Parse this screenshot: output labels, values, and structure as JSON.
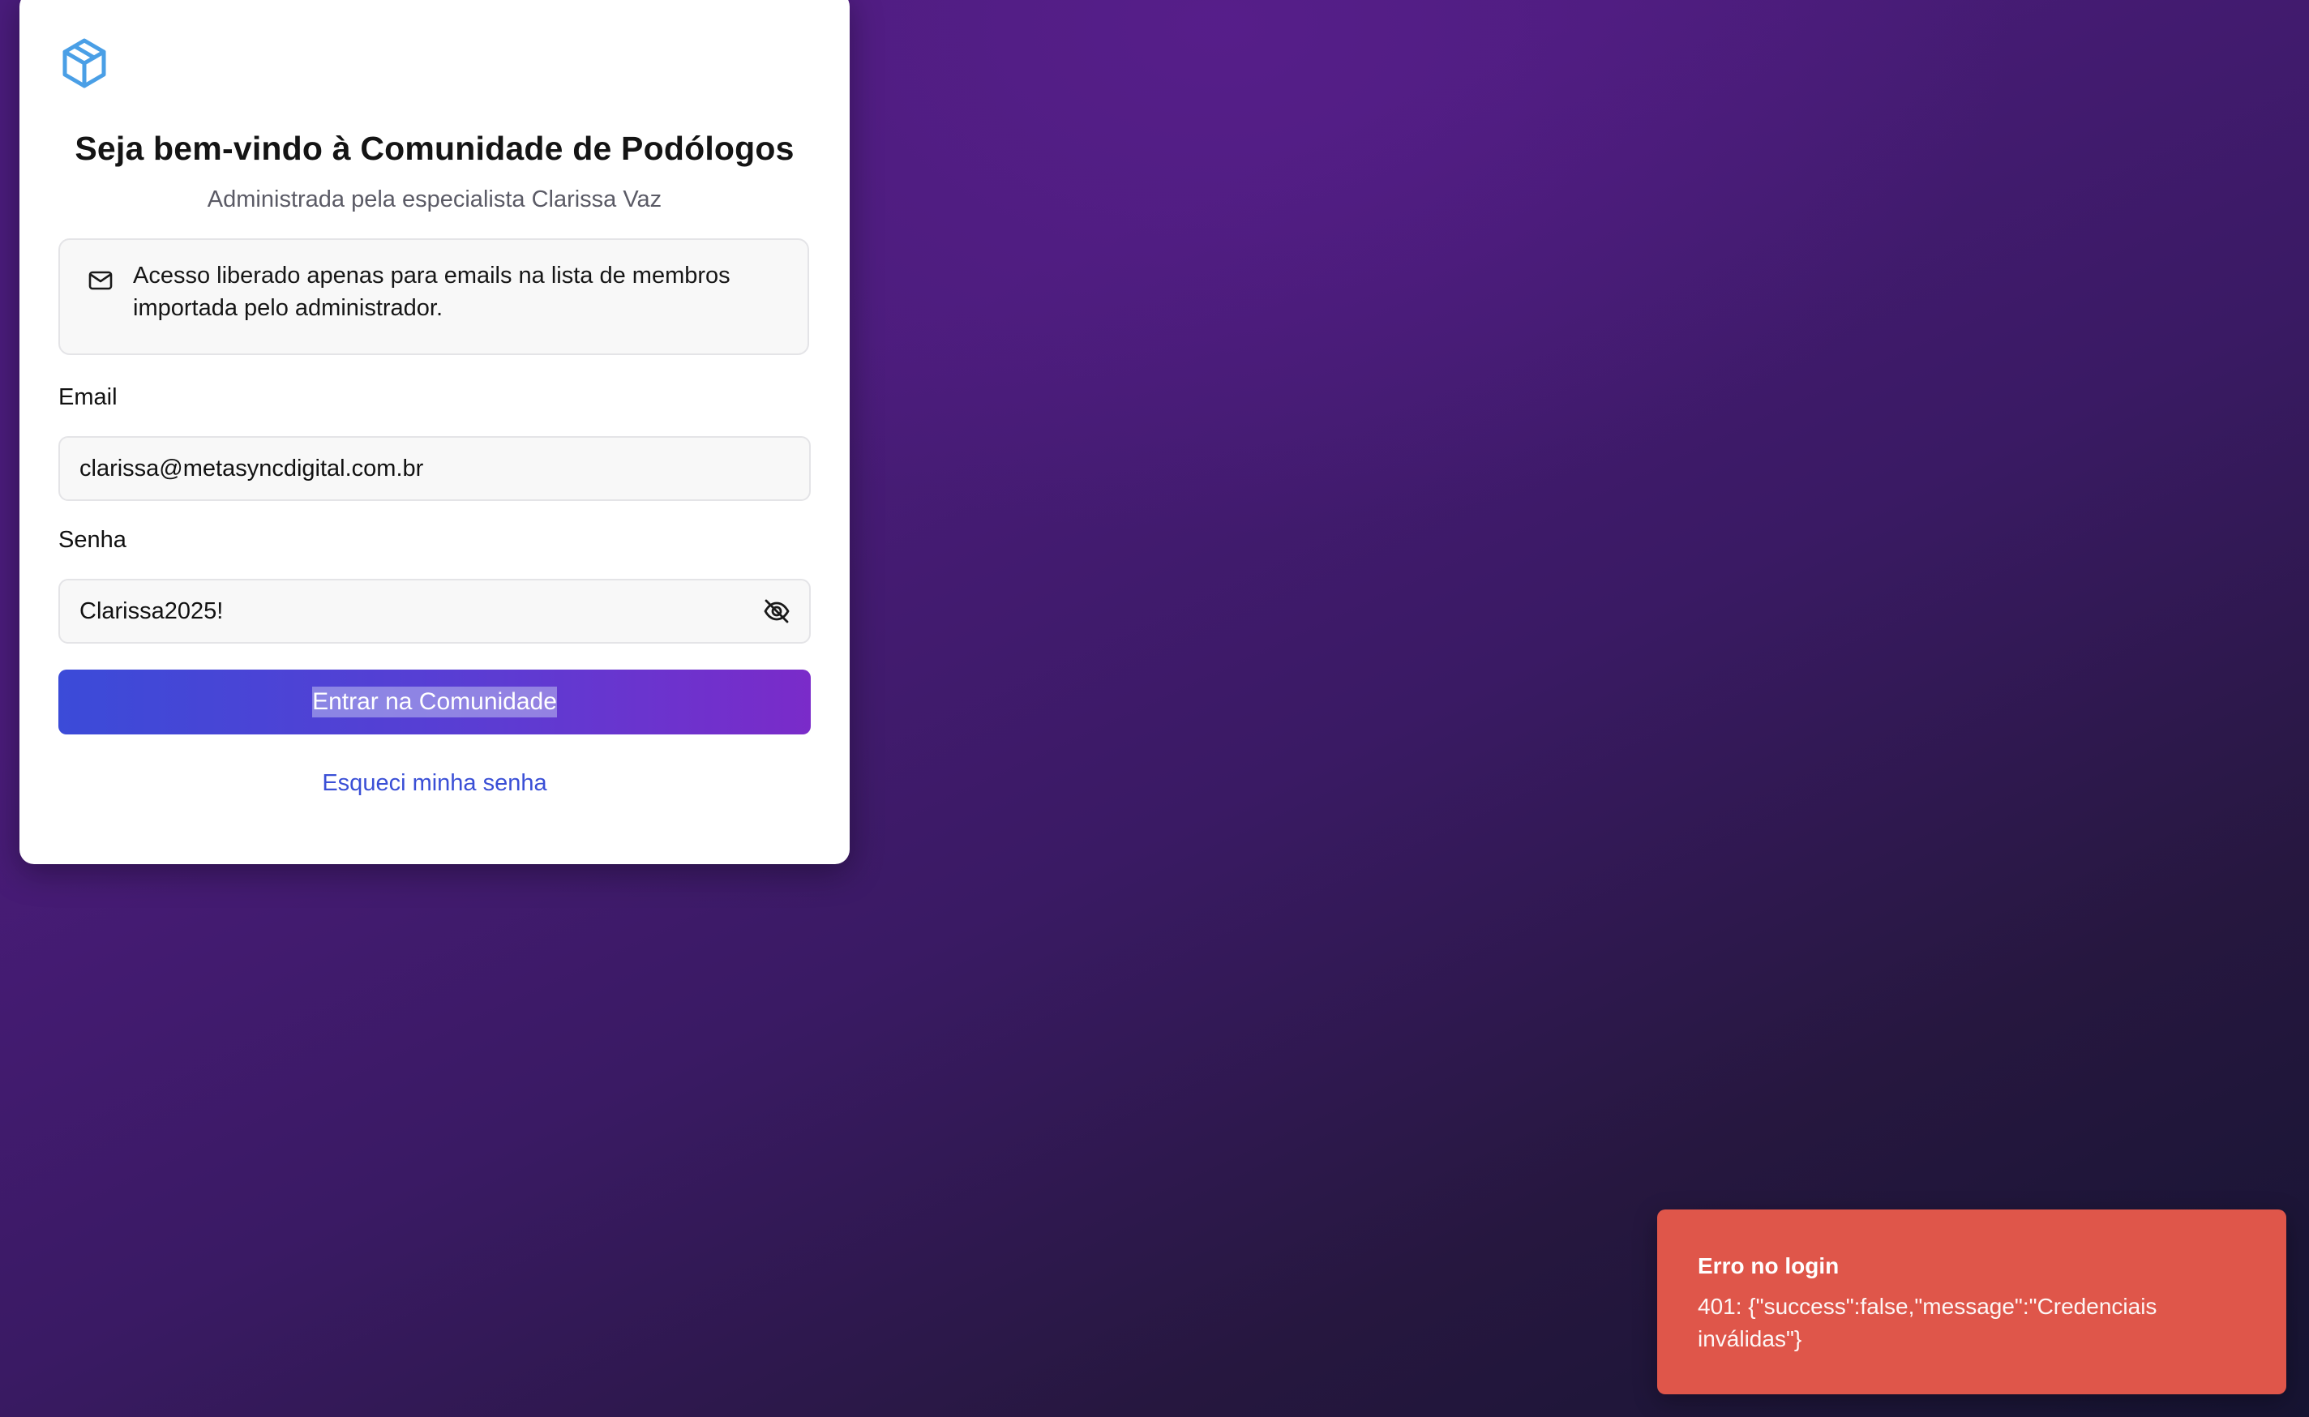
{
  "login": {
    "logo_icon": "cube-box-icon",
    "title": "Seja bem-vindo à Comunidade de Podólogos",
    "subtitle": "Administrada pela especialista Clarissa Vaz",
    "notice": {
      "icon": "mail-icon",
      "text": "Acesso liberado apenas para emails na lista de membros importada pelo administrador."
    },
    "email": {
      "label": "Email",
      "value": "clarissa@metasyncdigital.com.br"
    },
    "password": {
      "label": "Senha",
      "value": "Clarissa2025!",
      "toggle_icon": "eye-off-icon"
    },
    "submit_label": "Entrar na Comunidade",
    "forgot_label": "Esqueci minha senha"
  },
  "toast": {
    "title": "Erro no login",
    "message": "401: {\"success\":false,\"message\":\"Credenciais inválidas\"}"
  },
  "colors": {
    "accent": "#3b4bd8",
    "accent_end": "#7a2bc9",
    "link": "#3a4fd6",
    "error": "#df564a",
    "logo": "#4a9fe6"
  }
}
